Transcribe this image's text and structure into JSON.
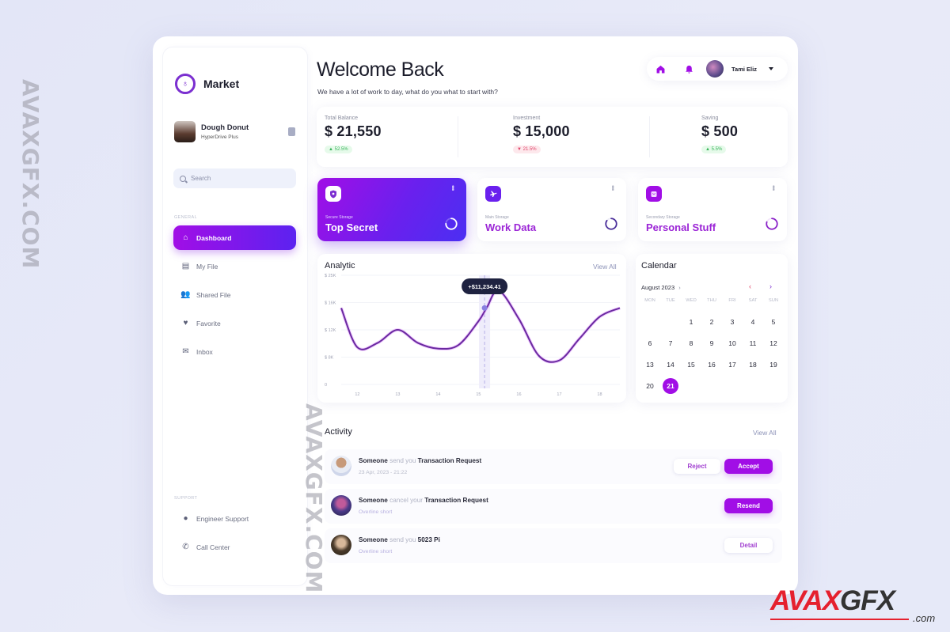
{
  "brand": {
    "name": "Market"
  },
  "profile": {
    "name": "Dough Donut",
    "plan": "HyperDrive Plus"
  },
  "search": {
    "placeholder": "Search"
  },
  "sidebar": {
    "general_label": "GENERAL",
    "items": [
      {
        "label": "Dashboard",
        "icon": "home-icon",
        "active": true
      },
      {
        "label": "My File",
        "icon": "file-icon"
      },
      {
        "label": "Shared File",
        "icon": "users-icon"
      },
      {
        "label": "Favorite",
        "icon": "heart-icon"
      },
      {
        "label": "Inbox",
        "icon": "mail-icon"
      }
    ],
    "support_label": "SUPPORT",
    "support_items": [
      {
        "label": "Engineer Support",
        "icon": "person-icon"
      },
      {
        "label": "Call Center",
        "icon": "phone-icon"
      }
    ]
  },
  "header": {
    "title": "Welcome Back",
    "subtitle": "We have a lot of work to day, what do you what to start with?",
    "user_name": "Tami Eliz"
  },
  "stats": [
    {
      "label": "Total Balance",
      "value": "$ 21,550",
      "change": "▲ 52.5%",
      "trend": "up"
    },
    {
      "label": "Investment",
      "value": "$ 15,000",
      "change": "▼ 21.5%",
      "trend": "down"
    },
    {
      "label": "Saving",
      "value": "$ 500",
      "change": "▲ 5.5%",
      "trend": "up"
    }
  ],
  "storage": [
    {
      "label": "Secure Storage",
      "title": "Top Secret",
      "icon": "shield-icon",
      "fill": 0.75
    },
    {
      "label": "Main Storage",
      "title": "Work Data",
      "icon": "plane-icon",
      "fill": 0.85
    },
    {
      "label": "Secondary Storage",
      "title": "Personal Stuff",
      "icon": "bag-icon",
      "fill": 0.8
    }
  ],
  "analytic": {
    "title": "Analytic",
    "view_all": "View All",
    "tooltip": "+$11,234.41"
  },
  "chart_data": {
    "type": "line",
    "title": "Analytic",
    "x": [
      11.6,
      12,
      12.5,
      13,
      13.5,
      14,
      14.5,
      15,
      15.2,
      15.5,
      16,
      16.5,
      17,
      17.5,
      18,
      18.5
    ],
    "values": [
      17.5,
      8.5,
      9.5,
      12.5,
      9.5,
      8.2,
      9.0,
      14.5,
      17.5,
      21.5,
      15.0,
      6.5,
      5.5,
      10.5,
      15.5,
      17.5
    ],
    "xticks": [
      "12",
      "13",
      "14",
      "15",
      "16",
      "17",
      "18"
    ],
    "yticks": [
      "0",
      "$ 8K",
      "$ 12K",
      "$ 16K",
      "$ 25K"
    ],
    "ylim": [
      0,
      25
    ],
    "highlight_x": 15,
    "highlight_label": "+$11,234.41",
    "grid": true,
    "legend": "none"
  },
  "calendar": {
    "title": "Calendar",
    "month": "August 2023",
    "weekdays": [
      "MON",
      "TUE",
      "WED",
      "THU",
      "FRI",
      "SAT",
      "SUN"
    ],
    "first_weekday_index": 2,
    "days_shown": 21,
    "selected": 21
  },
  "activity": {
    "title": "Activity",
    "view_all": "View All",
    "items": [
      {
        "actor": "Someone",
        "verb": "send you",
        "object": "Transaction Request",
        "sub": "23 Apr, 2023 - 21:22",
        "actions": [
          "Reject",
          "Accept"
        ]
      },
      {
        "actor": "Someone",
        "verb": "cancel your",
        "object": "Transaction Request",
        "sub": "Overline short",
        "actions": [
          "Resend"
        ]
      },
      {
        "actor": "Someone",
        "verb": "send you",
        "object": "5023 Pi",
        "sub": "Overline short",
        "actions": [
          "Detail"
        ]
      }
    ]
  },
  "watermark": {
    "text": "AVAXGFX.COM",
    "brand_left": "AVAX",
    "brand_right": "GFX",
    "brand_suffix": ".com"
  },
  "colors": {
    "accent": "#a10ee6",
    "accent2": "#5c22f0",
    "line": "#6a2aa0",
    "positive": "#3ab45c",
    "negative": "#e0456a"
  }
}
